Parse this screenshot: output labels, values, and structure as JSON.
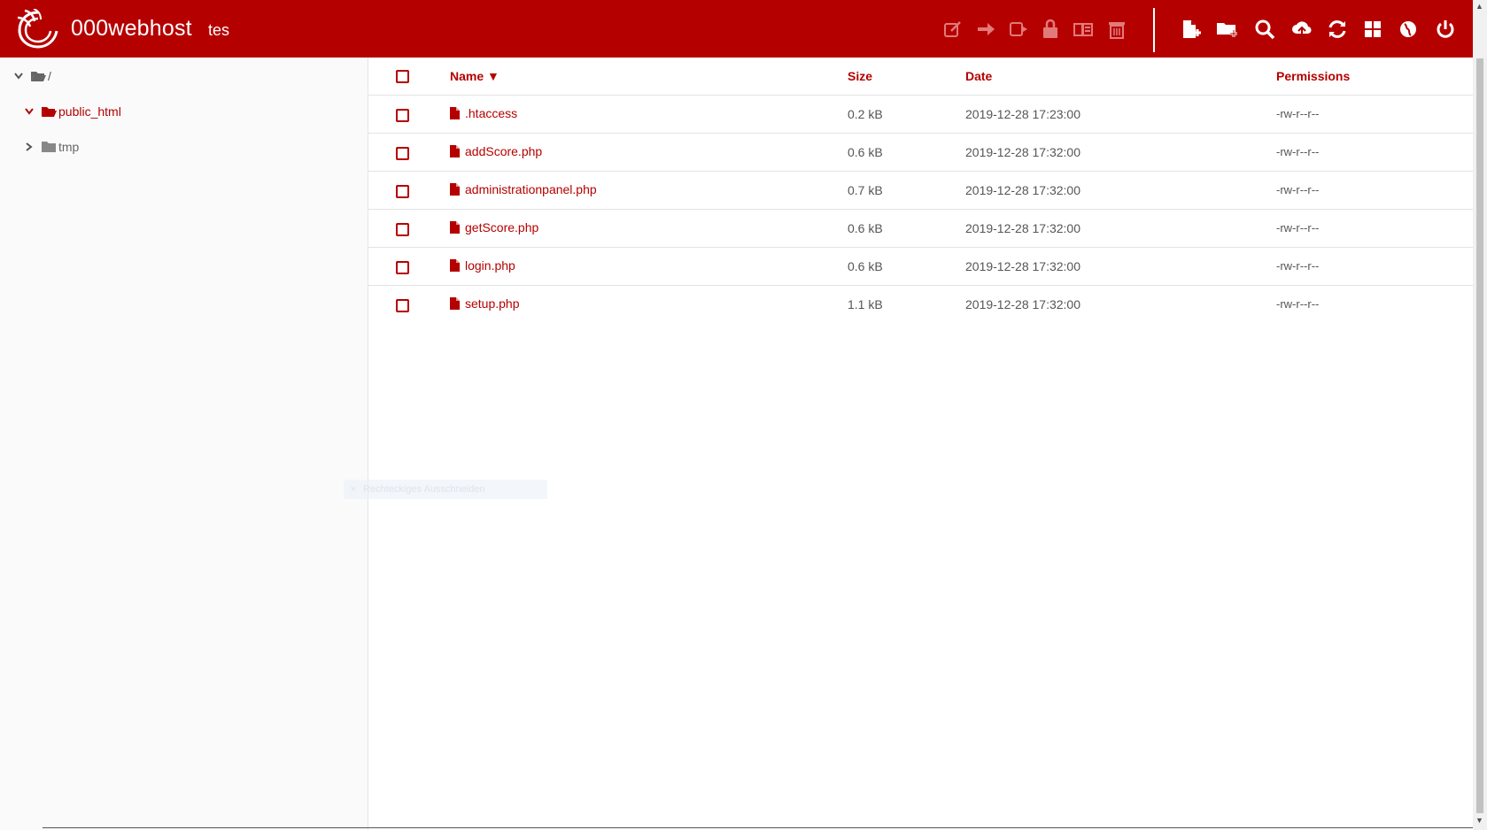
{
  "header": {
    "brand": "000webhost",
    "site": "tes",
    "toolbar_left": [
      "edit-icon",
      "move-icon",
      "copy-icon",
      "permissions-icon",
      "archive-icon",
      "delete-icon"
    ],
    "toolbar_right": [
      "new-file-icon",
      "new-folder-icon",
      "search-icon",
      "upload-icon",
      "refresh-icon",
      "view-grid-icon",
      "web-icon",
      "power-icon"
    ],
    "brand_color": "#b50000"
  },
  "sidebar": {
    "root": "/",
    "items": [
      {
        "label": "public_html",
        "expanded": true,
        "active": true
      },
      {
        "label": "tmp",
        "expanded": false,
        "active": false
      }
    ]
  },
  "table": {
    "columns": {
      "name": "Name ▼",
      "size": "Size",
      "date": "Date",
      "permissions": "Permissions"
    },
    "rows": [
      {
        "name": ".htaccess",
        "size": "0.2 kB",
        "date": "2019-12-28 17:23:00",
        "perms": "-rw-r--r--"
      },
      {
        "name": "addScore.php",
        "size": "0.6 kB",
        "date": "2019-12-28 17:32:00",
        "perms": "-rw-r--r--"
      },
      {
        "name": "administrationpanel.php",
        "size": "0.7 kB",
        "date": "2019-12-28 17:32:00",
        "perms": "-rw-r--r--"
      },
      {
        "name": "getScore.php",
        "size": "0.6 kB",
        "date": "2019-12-28 17:32:00",
        "perms": "-rw-r--r--"
      },
      {
        "name": "login.php",
        "size": "0.6 kB",
        "date": "2019-12-28 17:32:00",
        "perms": "-rw-r--r--"
      },
      {
        "name": "setup.php",
        "size": "1.1 kB",
        "date": "2019-12-28 17:32:00",
        "perms": "-rw-r--r--"
      }
    ]
  },
  "overlay": {
    "text": "Rechteckiges Ausschneiden"
  }
}
